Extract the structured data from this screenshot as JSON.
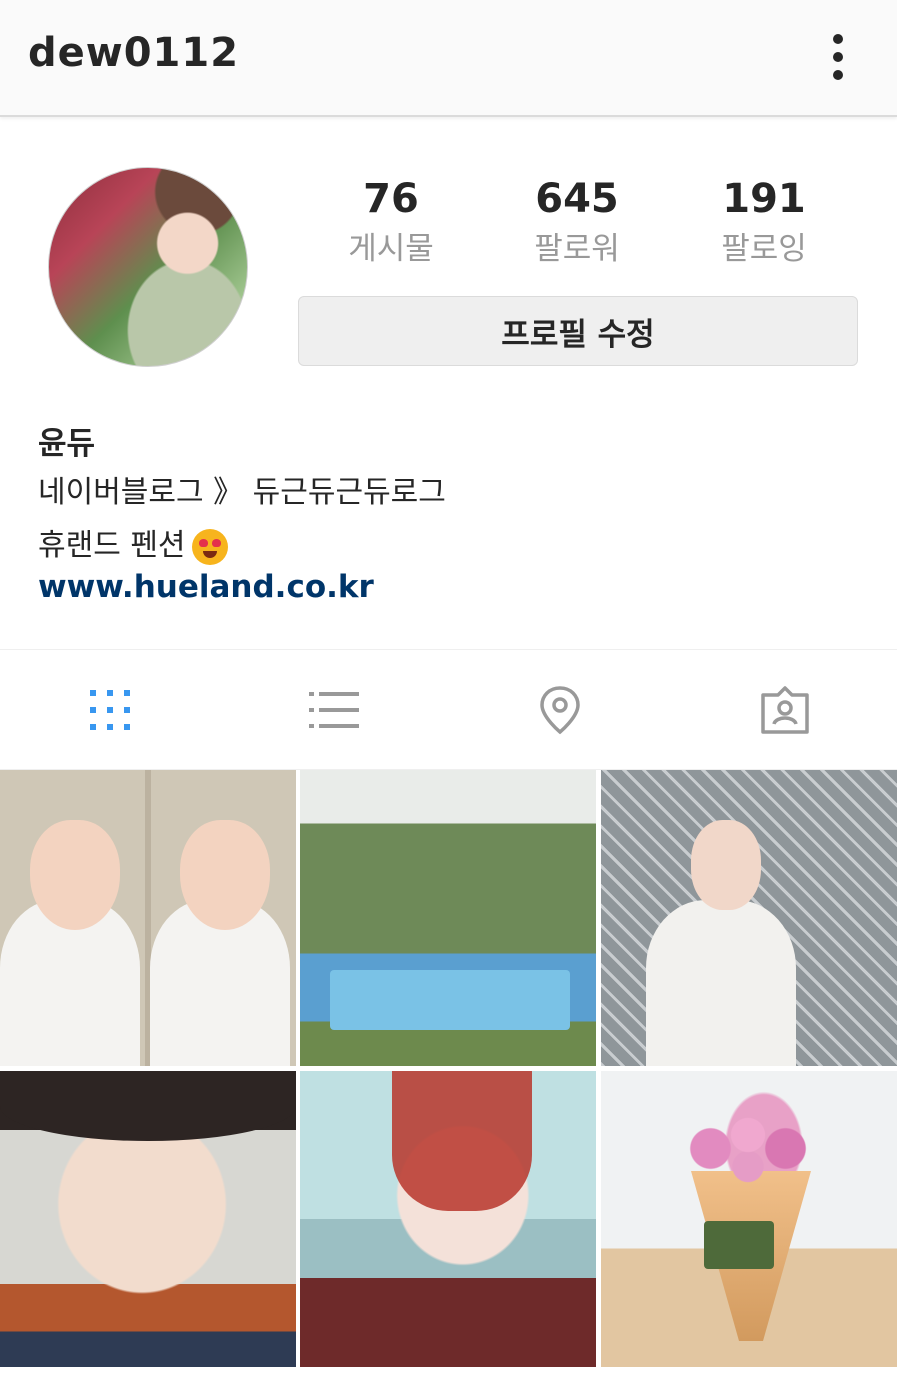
{
  "header": {
    "username": "dew0112",
    "menu_icon": "more-vertical-icon"
  },
  "profile": {
    "avatar_icon": "profile-photo",
    "stats": [
      {
        "value": "76",
        "label": "게시물"
      },
      {
        "value": "645",
        "label": "팔로워"
      },
      {
        "value": "191",
        "label": "팔로잉"
      }
    ],
    "edit_button": "프로필 수정",
    "name": "윤듀",
    "bio_lines": [
      "네이버블로그 》 듀근듀근듀로그",
      "휴랜드 펜션"
    ],
    "bio_emoji": "heart-eyes-emoji",
    "website": "www.hueland.co.kr"
  },
  "tabs": [
    {
      "name": "grid-icon",
      "active": true
    },
    {
      "name": "list-icon",
      "active": false
    },
    {
      "name": "location-pin-icon",
      "active": false
    },
    {
      "name": "tagged-icon",
      "active": false
    }
  ],
  "colors": {
    "accent": "#3897f0",
    "link": "#003569",
    "muted": "#999999",
    "text": "#262626"
  },
  "posts_count_visible": 6
}
